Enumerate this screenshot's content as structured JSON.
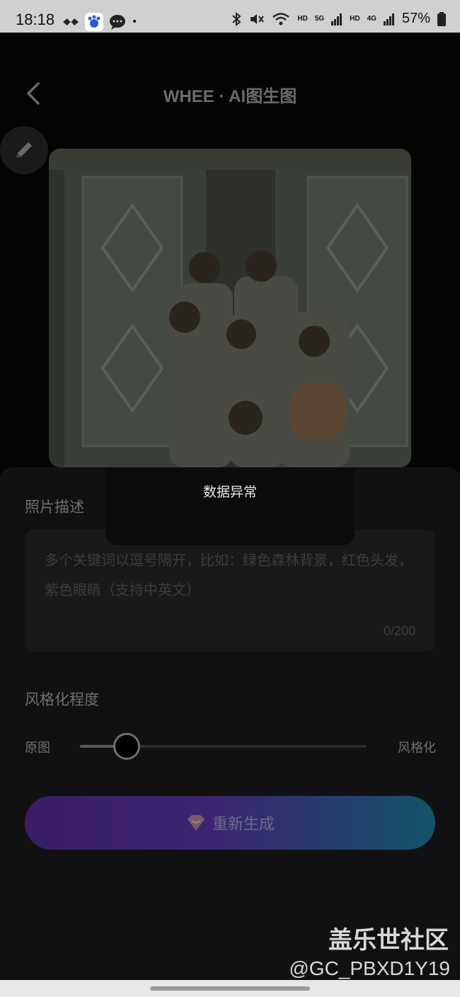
{
  "status_bar": {
    "time": "18:18",
    "dot": "•",
    "net1": "HD",
    "net2": "HD",
    "net_5g": "5G",
    "net_4g": "4G",
    "battery": "57%"
  },
  "header": {
    "title": "WHEE · AI图生图"
  },
  "panel": {
    "desc_label": "照片描述",
    "desc_placeholder": "多个关键词以逗号隔开，比如：绿色森林背景，红色头发，紫色眼睛（支持中英文）",
    "desc_count": "0/200",
    "style_label": "风格化程度",
    "slider_left": "原图",
    "slider_right": "风格化",
    "slider_value": 0.16,
    "regen_label": "重新生成"
  },
  "toast": {
    "text": "数据异常"
  },
  "watermark": {
    "name": "盖乐世社区",
    "user": "@GC_PBXD1Y19"
  }
}
